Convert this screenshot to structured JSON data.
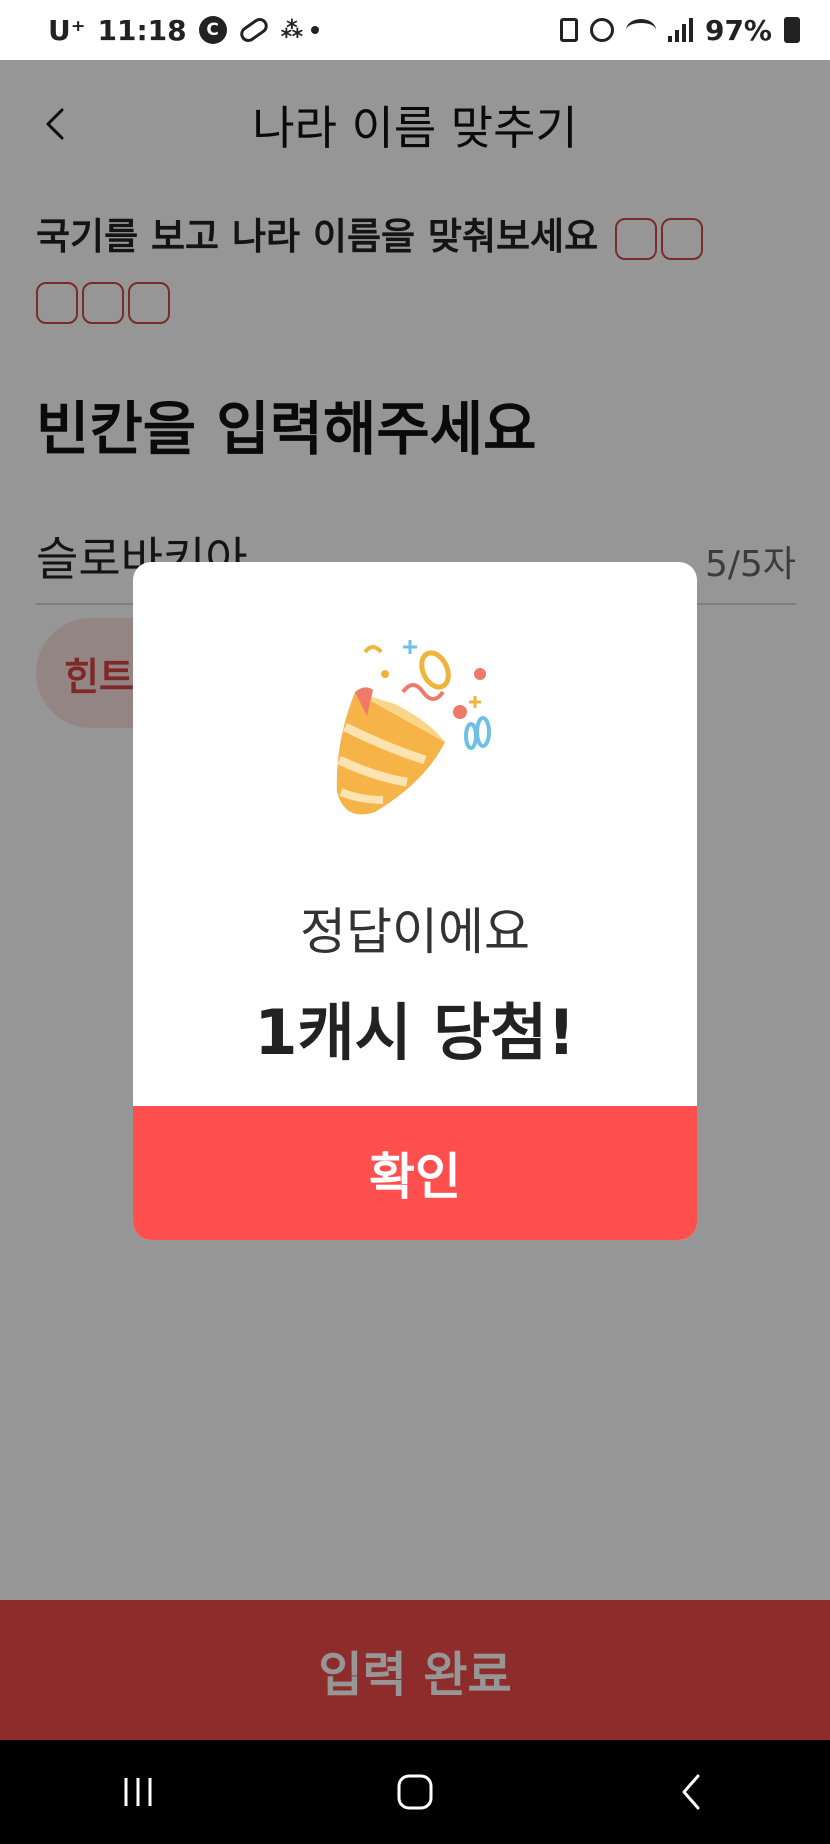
{
  "status_bar": {
    "carrier": "U⁺",
    "time": "11:18",
    "c_badge": "C",
    "battery": "97%"
  },
  "header": {
    "title": "나라 이름 맞추기"
  },
  "question": {
    "text": "국기를 보고 나라 이름을 맞춰보세요",
    "blank_count": 5
  },
  "instruction": "빈칸을 입력해주세요",
  "answer": {
    "value": "슬로바키아",
    "char_count": "5/5자"
  },
  "hint_label": "힌트",
  "submit_label": "입력 완료",
  "modal": {
    "message": "정답이에요",
    "reward": "1캐시 당첨!",
    "confirm_label": "확인"
  },
  "colors": {
    "accent": "#ff4f4f",
    "submit_bar": "#f24b4b",
    "hint_bg": "#fbe3e3",
    "hint_text": "#d64545"
  },
  "icons": {
    "back": "chevron-left-icon",
    "celebration": "party-popper-icon"
  }
}
